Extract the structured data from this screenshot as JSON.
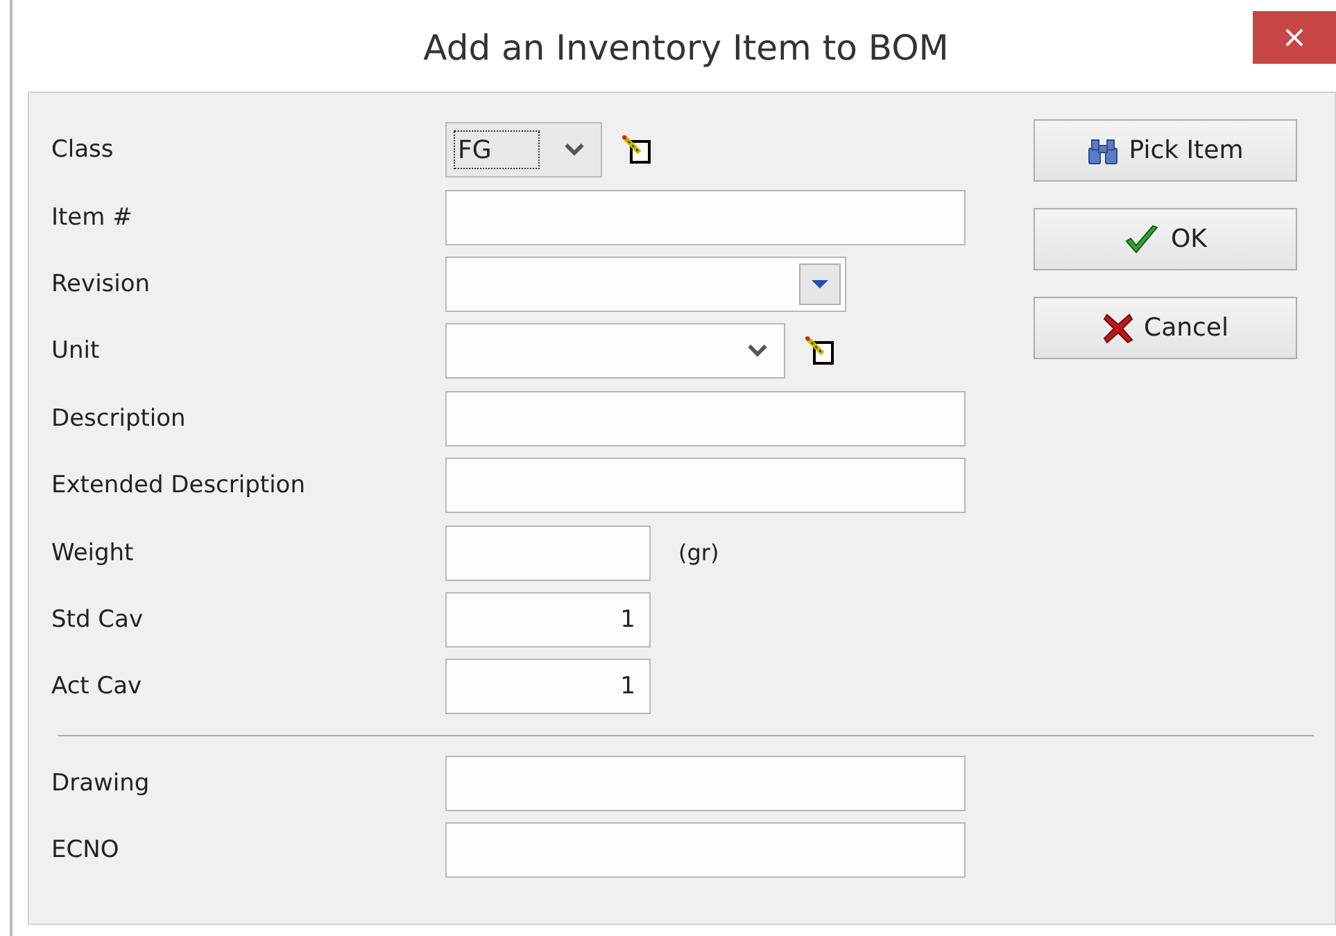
{
  "window": {
    "title": "Add an Inventory Item to BOM",
    "close": "×"
  },
  "fields": [
    {
      "label": "Class",
      "kind": "combo",
      "value": "FG",
      "focused": true,
      "edit": true
    },
    {
      "label": "Item #",
      "kind": "text"
    },
    {
      "label": "Revision",
      "kind": "dropdown"
    },
    {
      "label": "Unit",
      "kind": "combo",
      "edit": true
    },
    {
      "label": "Description",
      "kind": "text"
    },
    {
      "label": "Extended Description",
      "kind": "text"
    },
    {
      "label": "Weight",
      "kind": "text",
      "suffix": "(gr)"
    },
    {
      "label": "Std Cav",
      "kind": "number",
      "value": "1"
    },
    {
      "label": "Act Cav",
      "kind": "number",
      "value": "1"
    }
  ],
  "extra_fields": [
    {
      "label": "Drawing",
      "kind": "text"
    },
    {
      "label": "ECNO",
      "kind": "text"
    }
  ],
  "buttons": [
    {
      "label": "Pick Item",
      "kind": "pick"
    },
    {
      "label": "OK",
      "kind": "ok"
    },
    {
      "label": "Cancel",
      "kind": "cancel"
    }
  ]
}
